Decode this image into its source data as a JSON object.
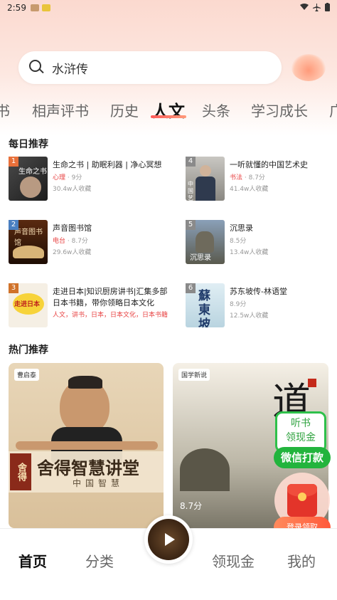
{
  "status_bar": {
    "time": "2:59"
  },
  "search": {
    "placeholder": "水浒传"
  },
  "categories": {
    "items": [
      "书",
      "相声评书",
      "历史",
      "人文",
      "头条",
      "学习成长",
      "广"
    ],
    "active": "人文"
  },
  "daily": {
    "title": "每日推荐",
    "items": [
      {
        "rank": "1",
        "title": "生命之书 | 助眠利器 | 净心冥想",
        "tag": "心理",
        "meta": "· 9分",
        "count": "30.4w人收藏"
      },
      {
        "rank": "4",
        "title": "一听就懂的中国艺术史",
        "tag": "书法",
        "meta": "· 8.7分",
        "count": "41.4w人收藏"
      },
      {
        "rank": "2",
        "title": "声音图书馆",
        "tag": "电台",
        "meta": "· 8.7分",
        "count": "29.6w人收藏"
      },
      {
        "rank": "5",
        "title": "沉思录",
        "tag": "",
        "meta": "8.5分",
        "count": "13.4w人收藏"
      },
      {
        "rank": "3",
        "title": "走进日本|知识厨房讲书|汇集多部日本书籍，带你领略日本文化",
        "tag": "人文，讲书，日本，日本文化，日本书籍",
        "meta": "",
        "count": ""
      },
      {
        "rank": "6",
        "title": "苏东坡传-林语堂",
        "tag": "",
        "meta": "8.9分",
        "count": "12.5w人收藏"
      }
    ],
    "cover_texts": [
      "生命之书",
      "声音图书馆",
      "走进日本",
      "中国艺术史",
      "沉思录",
      "蘇東坡"
    ]
  },
  "hot": {
    "title": "热门推荐",
    "cards": [
      {
        "badge": "曹启泰",
        "banner": "舍得智慧讲堂",
        "sub": "中国智慧",
        "side": "舍得"
      },
      {
        "badge": "国学新说",
        "score": "8.7分",
        "calligraphy": "道"
      }
    ]
  },
  "float": {
    "cash_line1": "听书",
    "cash_line2": "领现金",
    "cash_btn": "微信打款",
    "login_btn": "登录领取"
  },
  "tabbar": {
    "items": [
      "首页",
      "分类",
      "领现金",
      "我的"
    ],
    "active": "首页"
  },
  "colors": {
    "accent": "#e84343",
    "green": "#22b43d",
    "orange": "#ff6a3c"
  }
}
